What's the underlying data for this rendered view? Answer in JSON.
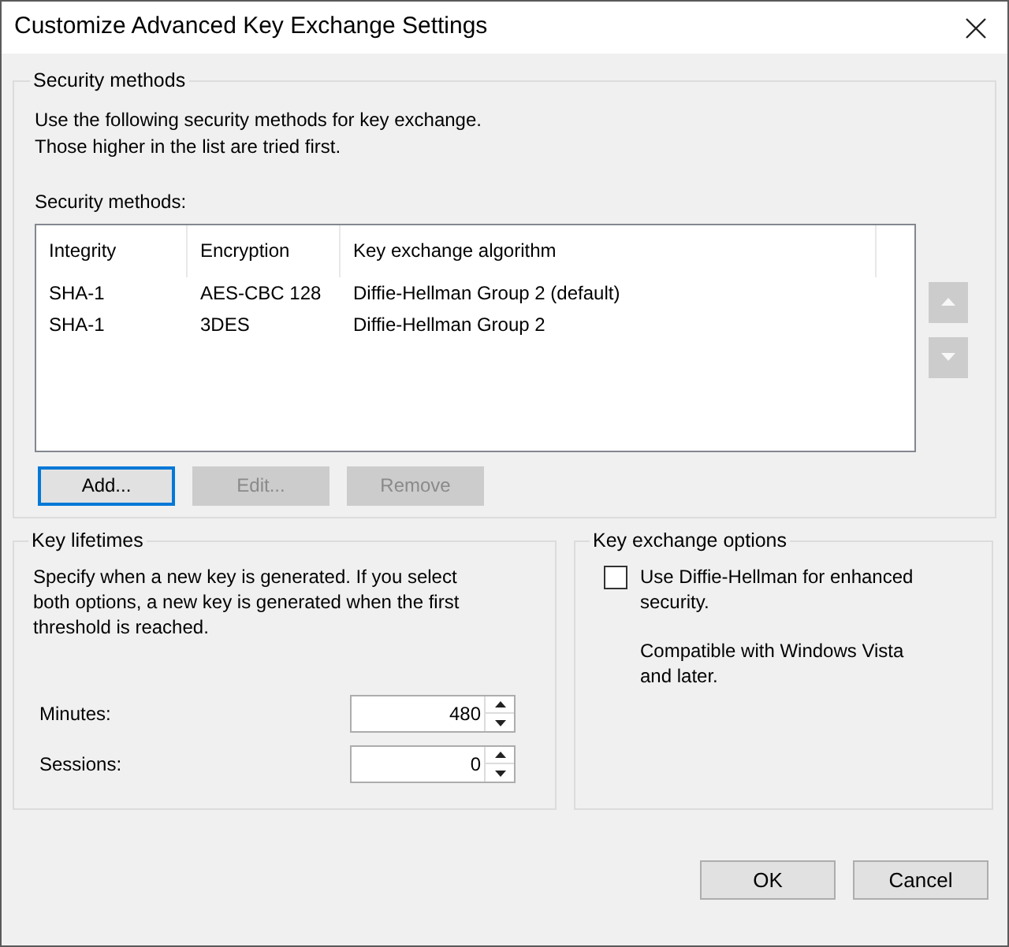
{
  "window": {
    "title": "Customize Advanced Key Exchange Settings"
  },
  "security_methods": {
    "title": "Security methods",
    "description": [
      "Use the following security methods for key exchange.",
      "Those higher in the list are tried first."
    ],
    "list_label": "Security methods:",
    "columns": [
      "Integrity",
      "Encryption",
      "Key exchange algorithm"
    ],
    "rows": [
      {
        "cells": [
          "SHA-1",
          "AES-CBC 128",
          "Diffie-Hellman Group 2 (default)"
        ],
        "selected": false
      },
      {
        "cells": [
          "SHA-1",
          "3DES",
          "Diffie-Hellman Group 2"
        ],
        "selected": false
      }
    ],
    "move_up": {
      "disabled": true
    },
    "move_down": {
      "disabled": true
    },
    "buttons": [
      {
        "label": "Add...",
        "disabled": false,
        "focused": true
      },
      {
        "label": "Edit...",
        "disabled": true,
        "focused": false
      },
      {
        "label": "Remove",
        "disabled": true,
        "focused": false
      }
    ]
  },
  "key_lifetimes": {
    "title": "Key lifetimes",
    "description": "Specify when a new key is generated. If you select both options, a new key is generated when the first threshold is reached.",
    "fields": [
      {
        "label": "Minutes:",
        "value": "480"
      },
      {
        "label": "Sessions:",
        "value": "0"
      }
    ]
  },
  "key_exchange_options": {
    "title": "Key exchange options",
    "checkbox": {
      "label": "Use Diffie-Hellman for enhanced security.",
      "checked": false
    },
    "note": "Compatible with Windows Vista and later."
  },
  "buttons": [
    {
      "label": "OK"
    },
    {
      "label": "Cancel"
    }
  ]
}
